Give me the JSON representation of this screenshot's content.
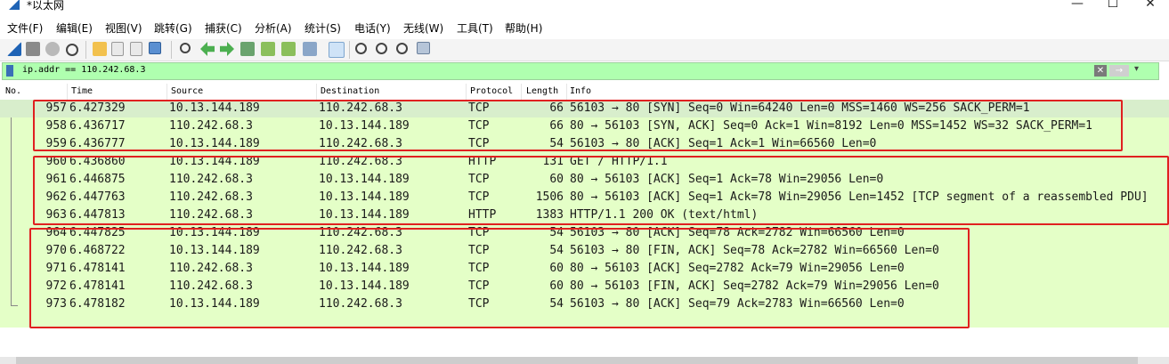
{
  "window": {
    "title": "*以太网",
    "minimize": "—",
    "maximize": "☐",
    "close": "✕"
  },
  "menu": [
    "文件(F)",
    "编辑(E)",
    "视图(V)",
    "跳转(G)",
    "捕获(C)",
    "分析(A)",
    "统计(S)",
    "电话(Y)",
    "无线(W)",
    "工具(T)",
    "帮助(H)"
  ],
  "filter": {
    "text": "ip.addr == 110.242.68.3",
    "clear": "✕",
    "apply": "→",
    "dropdown": "▾"
  },
  "columns": {
    "no": "No.",
    "time": "Time",
    "source": "Source",
    "destination": "Destination",
    "protocol": "Protocol",
    "length": "Length",
    "info": "Info"
  },
  "packets": [
    {
      "no": "957",
      "time": "6.427329",
      "src": "10.13.144.189",
      "dst": "110.242.68.3",
      "proto": "TCP",
      "len": "66",
      "info": "56103 → 80 [SYN] Seq=0 Win=64240 Len=0 MSS=1460 WS=256 SACK_PERM=1"
    },
    {
      "no": "958",
      "time": "6.436717",
      "src": "110.242.68.3",
      "dst": "10.13.144.189",
      "proto": "TCP",
      "len": "66",
      "info": "80 → 56103 [SYN, ACK] Seq=0 Ack=1 Win=8192 Len=0 MSS=1452 WS=32 SACK_PERM=1"
    },
    {
      "no": "959",
      "time": "6.436777",
      "src": "10.13.144.189",
      "dst": "110.242.68.3",
      "proto": "TCP",
      "len": "54",
      "info": "56103 → 80 [ACK] Seq=1 Ack=1 Win=66560 Len=0"
    },
    {
      "no": "960",
      "time": "6.436860",
      "src": "10.13.144.189",
      "dst": "110.242.68.3",
      "proto": "HTTP",
      "len": "131",
      "info": "GET / HTTP/1.1"
    },
    {
      "no": "961",
      "time": "6.446875",
      "src": "110.242.68.3",
      "dst": "10.13.144.189",
      "proto": "TCP",
      "len": "60",
      "info": "80 → 56103 [ACK] Seq=1 Ack=78 Win=29056 Len=0"
    },
    {
      "no": "962",
      "time": "6.447763",
      "src": "110.242.68.3",
      "dst": "10.13.144.189",
      "proto": "TCP",
      "len": "1506",
      "info": "80 → 56103 [ACK] Seq=1 Ack=78 Win=29056 Len=1452 [TCP segment of a reassembled PDU]"
    },
    {
      "no": "963",
      "time": "6.447813",
      "src": "110.242.68.3",
      "dst": "10.13.144.189",
      "proto": "HTTP",
      "len": "1383",
      "info": "HTTP/1.1 200 OK  (text/html)"
    },
    {
      "no": "964",
      "time": "6.447825",
      "src": "10.13.144.189",
      "dst": "110.242.68.3",
      "proto": "TCP",
      "len": "54",
      "info": "56103 → 80 [ACK] Seq=78 Ack=2782 Win=66560 Len=0"
    },
    {
      "no": "970",
      "time": "6.468722",
      "src": "10.13.144.189",
      "dst": "110.242.68.3",
      "proto": "TCP",
      "len": "54",
      "info": "56103 → 80 [FIN, ACK] Seq=78 Ack=2782 Win=66560 Len=0"
    },
    {
      "no": "971",
      "time": "6.478141",
      "src": "110.242.68.3",
      "dst": "10.13.144.189",
      "proto": "TCP",
      "len": "60",
      "info": "80 → 56103 [ACK] Seq=2782 Ack=79 Win=29056 Len=0"
    },
    {
      "no": "972",
      "time": "6.478141",
      "src": "110.242.68.3",
      "dst": "10.13.144.189",
      "proto": "TCP",
      "len": "60",
      "info": "80 → 56103 [FIN, ACK] Seq=2782 Ack=79 Win=29056 Len=0"
    },
    {
      "no": "973",
      "time": "6.478182",
      "src": "10.13.144.189",
      "dst": "110.242.68.3",
      "proto": "TCP",
      "len": "54",
      "info": "56103 → 80 [ACK] Seq=79 Ack=2783 Win=66560 Len=0"
    }
  ],
  "colors": {
    "tcp_row_bg": "#e4ffc7",
    "filter_bg": "#afffaf",
    "annotation": "#e02020"
  }
}
